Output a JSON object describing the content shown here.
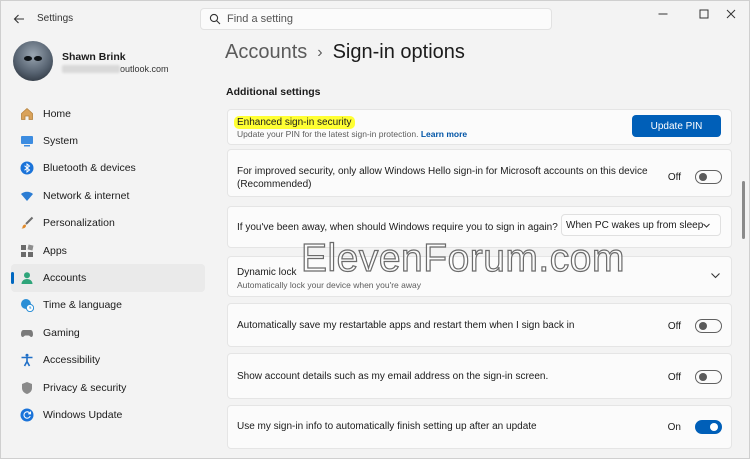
{
  "titlebar": {
    "app_title": "Settings",
    "search_placeholder": "Find a setting"
  },
  "profile": {
    "name": "Shawn Brink",
    "email_visible": "outlook.com"
  },
  "sidebar": {
    "items": [
      {
        "label": "Home",
        "icon": "home-icon",
        "active": false
      },
      {
        "label": "System",
        "icon": "system-icon",
        "active": false
      },
      {
        "label": "Bluetooth & devices",
        "icon": "bluetooth-icon",
        "active": false
      },
      {
        "label": "Network & internet",
        "icon": "wifi-icon",
        "active": false
      },
      {
        "label": "Personalization",
        "icon": "brush-icon",
        "active": false
      },
      {
        "label": "Apps",
        "icon": "apps-icon",
        "active": false
      },
      {
        "label": "Accounts",
        "icon": "account-icon",
        "active": true
      },
      {
        "label": "Time & language",
        "icon": "globe-clock-icon",
        "active": false
      },
      {
        "label": "Gaming",
        "icon": "gamepad-icon",
        "active": false
      },
      {
        "label": "Accessibility",
        "icon": "accessibility-icon",
        "active": false
      },
      {
        "label": "Privacy & security",
        "icon": "shield-icon",
        "active": false
      },
      {
        "label": "Windows Update",
        "icon": "update-icon",
        "active": false
      }
    ]
  },
  "breadcrumb": {
    "parent": "Accounts",
    "separator": "›",
    "current": "Sign-in options"
  },
  "section": {
    "title": "Additional settings"
  },
  "cards": {
    "enhanced": {
      "title": "Enhanced sign-in security",
      "subtitle": "Update your PIN for the latest sign-in protection.",
      "link": "Learn more",
      "button": "Update PIN"
    },
    "hello_only": {
      "title_line1": "For improved security, only allow Windows Hello sign-in for Microsoft accounts on this device",
      "title_line2": "(Recommended)",
      "state": "Off",
      "on": false
    },
    "require_signin": {
      "title": "If you've been away, when should Windows require you to sign in again?",
      "value": "When PC wakes up from sleep"
    },
    "dynamic_lock": {
      "title": "Dynamic lock",
      "subtitle": "Automatically lock your device when you're away"
    },
    "restart_apps": {
      "title": "Automatically save my restartable apps and restart them when I sign back in",
      "state": "Off",
      "on": false
    },
    "account_details": {
      "title": "Show account details such as my email address on the sign-in screen.",
      "state": "Off",
      "on": false
    },
    "signin_info": {
      "title": "Use my sign-in info to automatically finish setting up after an update",
      "state": "On",
      "on": true
    }
  },
  "watermark": "ElevenForum.com",
  "colors": {
    "accent": "#005fb8",
    "highlight": "#ffff33",
    "link": "#0054a6"
  }
}
